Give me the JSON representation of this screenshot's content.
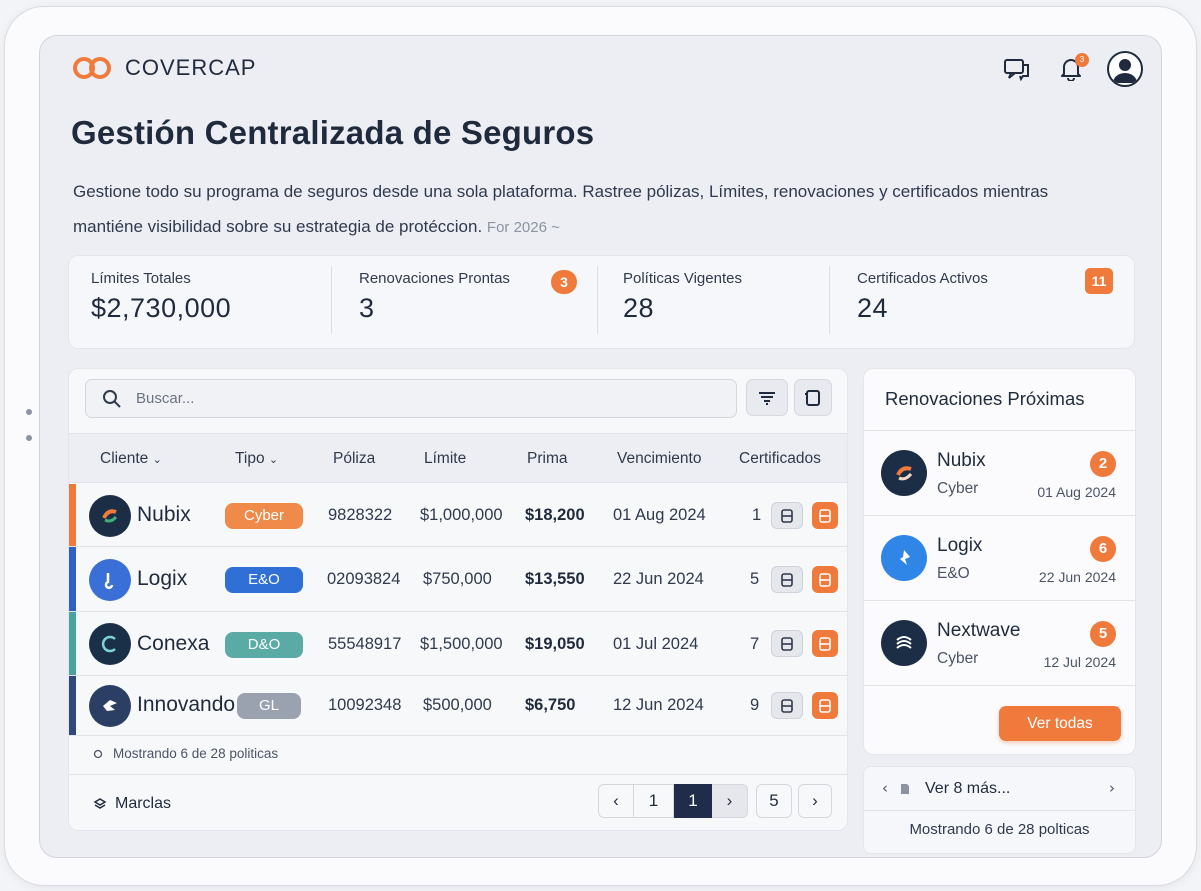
{
  "app": {
    "name": "COVERCAP"
  },
  "header": {
    "notifications_count": "3"
  },
  "page": {
    "title": "Gestión Centralizada de Seguros",
    "description": "Gestione todo su programa de seguros desde una sola plataforma. Rastree pólizas, Límites, renovaciones y certificados mientras mantiéne visibilidad sobre su estrategia de protéccion.",
    "year_selector": "For 2026 ~"
  },
  "stats": [
    {
      "label": "Límites Totales",
      "value": "$2,730,000"
    },
    {
      "label": "Renovaciones Prontas",
      "value": "3",
      "badge": "3"
    },
    {
      "label": "Políticas Vigentes",
      "value": "28"
    },
    {
      "label": "Certificados Activos",
      "value": "24",
      "badge": "11"
    }
  ],
  "table": {
    "search_placeholder": "Buscar...",
    "columns": {
      "client": "Cliente",
      "type": "Tipo",
      "policy": "Póliza",
      "limit": "Límite",
      "premium": "Prima",
      "expiry": "Vencimiento",
      "certificates": "Certificados"
    },
    "rows": [
      {
        "client": "Nubix",
        "type": "Cyber",
        "policy": "9828322",
        "limit": "$1,000,000",
        "premium": "$18,200",
        "expiry": "01 Aug 2024",
        "certificates": "1",
        "accent": "#ef7a3c",
        "type_color": "#ef8a4a",
        "logo_color": "#1c2e45"
      },
      {
        "client": "Logix",
        "type": "E&O",
        "policy": "02093824",
        "limit": "$750,000",
        "premium": "$13,550",
        "expiry": "22 Jun 2024",
        "certificates": "5",
        "accent": "#2f5fc7",
        "type_color": "#2f6fd6",
        "logo_color": "#3a6fd8"
      },
      {
        "client": "Conexa",
        "type": "D&O",
        "policy": "55548917",
        "limit": "$1,500,000",
        "premium": "$19,050",
        "expiry": "01 Jul 2024",
        "certificates": "7",
        "accent": "#4aa3a0",
        "type_color": "#5aaaa6",
        "logo_color": "#1a3049"
      },
      {
        "client": "Innovando",
        "type": "GL",
        "policy": "10092348",
        "limit": "$500,000",
        "premium": "$6,750",
        "expiry": "12 Jun 2024",
        "certificates": "9",
        "accent": "#2f4a7a",
        "type_color": "#9aa2b0",
        "logo_color": "#2b3e63"
      }
    ],
    "showing": "Mostrando 6 de 28 politicas",
    "footer_label": "Marclas",
    "pagination": {
      "prev": "‹",
      "pages": [
        "1",
        "1"
      ],
      "next_small": "›",
      "last": "5",
      "next": "›"
    }
  },
  "renewals": {
    "title": "Renovaciones Próximas",
    "items": [
      {
        "name": "Nubix",
        "type": "Cyber",
        "date": "01 Aug 2024",
        "badge": "2",
        "logo_color": "#1c2e45"
      },
      {
        "name": "Logix",
        "type": "E&O",
        "date": "22 Jun 2024",
        "badge": "6",
        "logo_color": "#2f86e6"
      },
      {
        "name": "Nextwave",
        "type": "Cyber",
        "date": "12 Jul 2024",
        "badge": "5",
        "logo_color": "#1c2e45"
      }
    ],
    "view_all": "Ver todas",
    "more": "Ver 8 más...",
    "showing": "Mostrando 6 de 28 polticas"
  },
  "colors": {
    "accent": "#ef7a3c",
    "navy": "#1f2b3d"
  }
}
